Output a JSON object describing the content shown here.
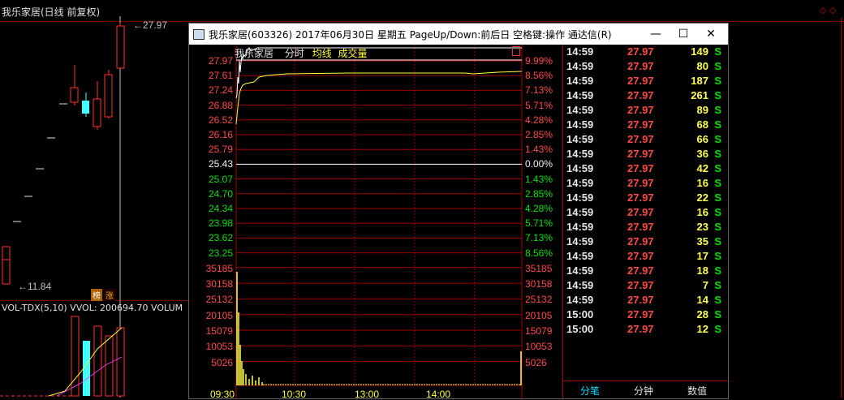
{
  "background": {
    "title": "我乐家居(日线 前复权)",
    "price_high_label": "27.97",
    "price_low_label": "11.84",
    "vol_label": "VOL-TDX(5,10)  VVOL: 200694.70  VOLUM",
    "badge1": "榜",
    "badge2": "涨",
    "colors": {
      "up": "#ff3030",
      "down": "#40ffff",
      "grid": "#800000"
    }
  },
  "dialog": {
    "title": "我乐家居(603326) 2017年06月30日  星期五  PageUp/Down:前后日  空格键:操作  通达信(R)",
    "minimize_icon": "minimize-icon",
    "maximize_icon": "maximize-icon",
    "close_icon": "close-icon",
    "chart_header": {
      "name": "我乐家居",
      "tab_time": "分时",
      "tab_avg": "均线",
      "tab_vol": "成交量"
    },
    "price_labels": [
      "27.97",
      "27.61",
      "27.24",
      "26.88",
      "26.52",
      "26.16",
      "25.79",
      "25.43",
      "25.07",
      "24.70",
      "24.34",
      "23.98",
      "23.62",
      "23.25"
    ],
    "pct_labels": [
      "9.99%",
      "8.56%",
      "7.13%",
      "5.71%",
      "4.28%",
      "2.85%",
      "1.43%",
      "0.00%",
      "1.43%",
      "2.85%",
      "4.28%",
      "5.71%",
      "7.13%",
      "8.56%"
    ],
    "vol_labels": [
      "35185",
      "30158",
      "25132",
      "20105",
      "15079",
      "10053",
      "5026"
    ],
    "time_labels": [
      "09:30",
      "10:30",
      "13:00",
      "14:00"
    ],
    "ticks": [
      {
        "time": "14:59",
        "price": "27.97",
        "vol": "149",
        "side": "S"
      },
      {
        "time": "14:59",
        "price": "27.97",
        "vol": "80",
        "side": "S"
      },
      {
        "time": "14:59",
        "price": "27.97",
        "vol": "187",
        "side": "S"
      },
      {
        "time": "14:59",
        "price": "27.97",
        "vol": "261",
        "side": "S"
      },
      {
        "time": "14:59",
        "price": "27.97",
        "vol": "89",
        "side": "S"
      },
      {
        "time": "14:59",
        "price": "27.97",
        "vol": "68",
        "side": "S"
      },
      {
        "time": "14:59",
        "price": "27.97",
        "vol": "66",
        "side": "S"
      },
      {
        "time": "14:59",
        "price": "27.97",
        "vol": "36",
        "side": "S"
      },
      {
        "time": "14:59",
        "price": "27.97",
        "vol": "42",
        "side": "S"
      },
      {
        "time": "14:59",
        "price": "27.97",
        "vol": "16",
        "side": "S"
      },
      {
        "time": "14:59",
        "price": "27.97",
        "vol": "22",
        "side": "S"
      },
      {
        "time": "14:59",
        "price": "27.97",
        "vol": "16",
        "side": "S"
      },
      {
        "time": "14:59",
        "price": "27.97",
        "vol": "23",
        "side": "S"
      },
      {
        "time": "14:59",
        "price": "27.97",
        "vol": "35",
        "side": "S"
      },
      {
        "time": "14:59",
        "price": "27.97",
        "vol": "17",
        "side": "S"
      },
      {
        "time": "14:59",
        "price": "27.97",
        "vol": "18",
        "side": "S"
      },
      {
        "time": "14:59",
        "price": "27.97",
        "vol": "7",
        "side": "S"
      },
      {
        "time": "14:59",
        "price": "27.97",
        "vol": "14",
        "side": "S"
      },
      {
        "time": "15:00",
        "price": "27.97",
        "vol": "28",
        "side": "S"
      },
      {
        "time": "15:00",
        "price": "27.97",
        "vol": "12",
        "side": "S"
      }
    ],
    "tabs": [
      "分笔",
      "分钟",
      "数值"
    ]
  }
}
